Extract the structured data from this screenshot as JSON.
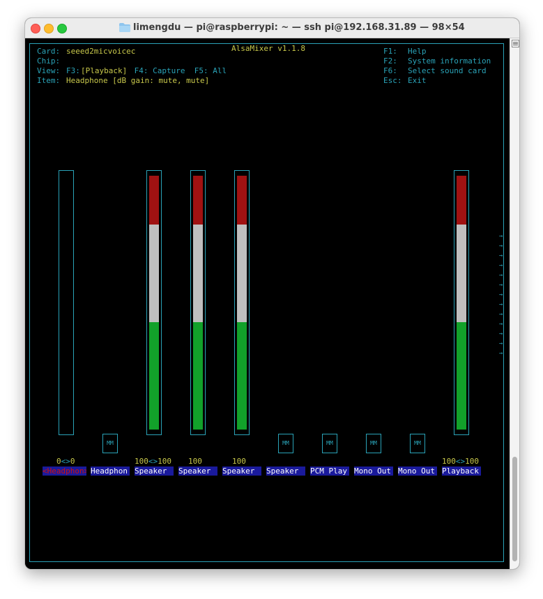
{
  "window": {
    "title": "limengdu — pi@raspberrypi: ~ — ssh pi@192.168.31.89 — 98×54"
  },
  "mixer": {
    "frame_title": "AlsaMixer v1.1.8",
    "card_label": "Card:",
    "card_value": "seeed2micvoicec",
    "chip_label": "Chip:",
    "view_label": "View:",
    "view_f3_key": "F3:",
    "view_f3_value": "[Playback]",
    "view_rest": " F4: Capture  F5: All",
    "item_label": "Item:",
    "item_value": "Headphone [dB gain: mute, mute]",
    "help": [
      {
        "key": "F1:",
        "desc": "Help"
      },
      {
        "key": "F2:",
        "desc": "System information"
      },
      {
        "key": "F6:",
        "desc": "Select sound card"
      },
      {
        "key": "Esc:",
        "desc": "Exit"
      }
    ],
    "mute_label": "MM",
    "values": {
      "headphone_left": "0",
      "headphone_sep": "<>",
      "headphone_right": "0",
      "speaker1_left": "100",
      "speaker1_sep": "<>",
      "speaker1_right": "100",
      "speaker2": "100",
      "speaker3": "100",
      "playback_left": "100",
      "playback_sep": "<>",
      "playback_right": "100"
    },
    "controls": [
      {
        "label": "<Headphon>",
        "level": 0
      },
      {
        "label": "Headphon",
        "level": null
      },
      {
        "label": "Speaker ",
        "level": 100
      },
      {
        "label": "Speaker ",
        "level": 100
      },
      {
        "label": "Speaker ",
        "level": 100
      },
      {
        "label": "Speaker ",
        "level": null
      },
      {
        "label": "PCM Play",
        "level": null
      },
      {
        "label": "Mono Out",
        "level": null
      },
      {
        "label": "Mono Out",
        "level": null
      },
      {
        "label": "Playback",
        "level": 100
      }
    ],
    "more_arrow": "→"
  }
}
